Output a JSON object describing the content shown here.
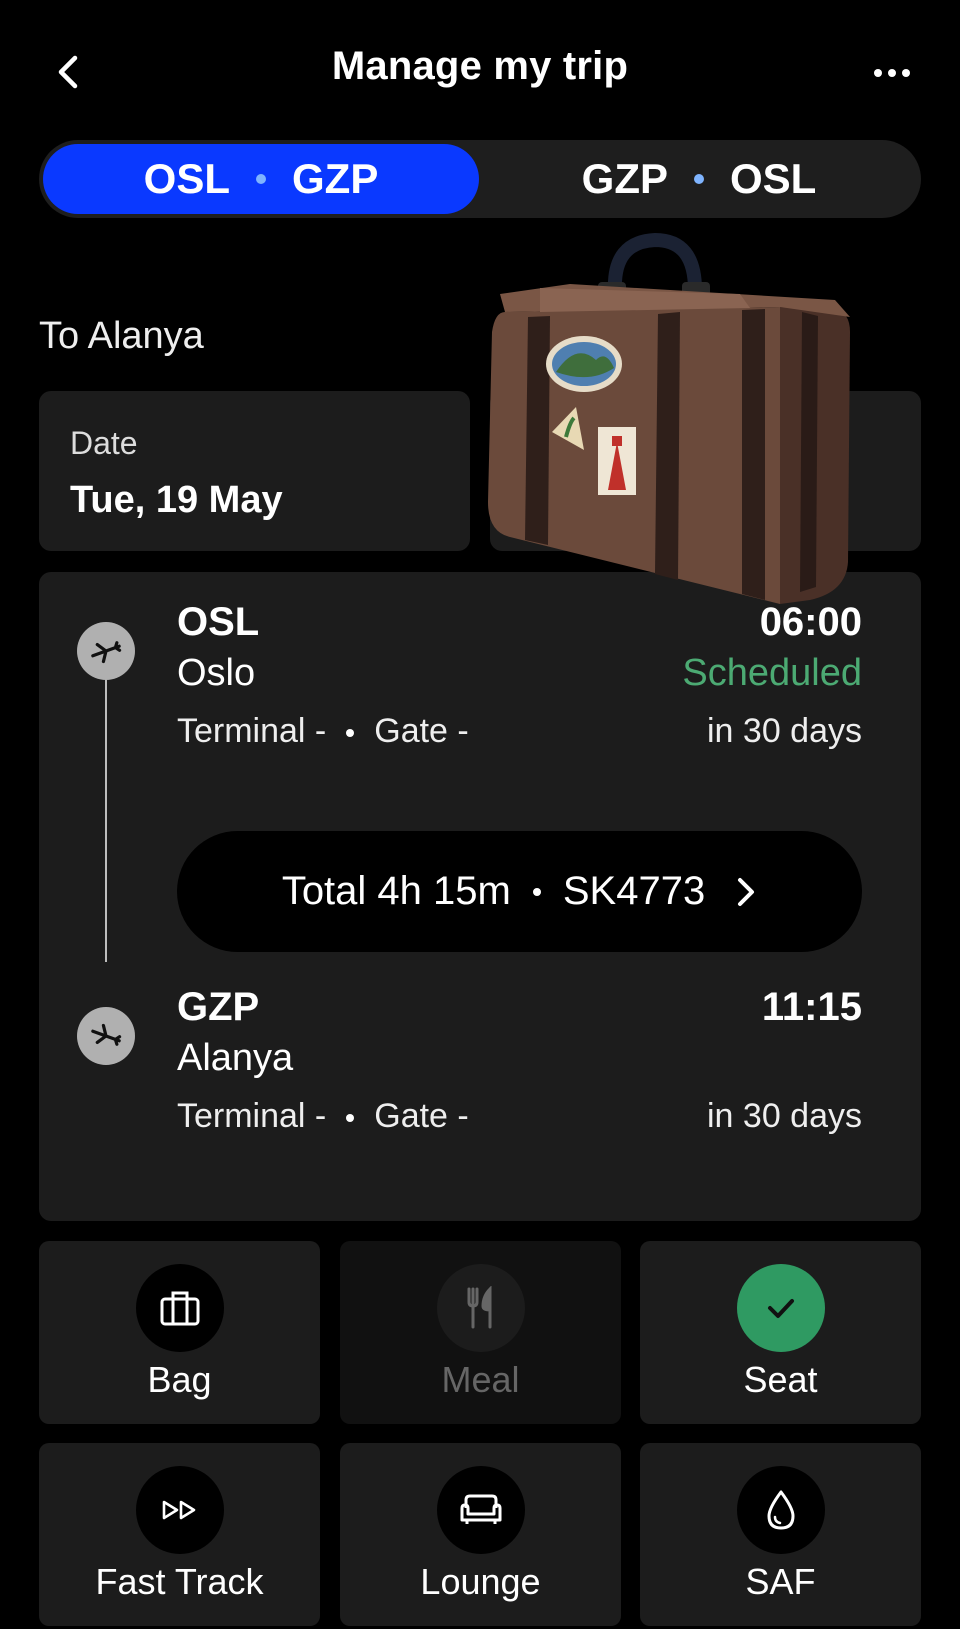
{
  "header": {
    "title": "Manage my trip",
    "back_icon": "chevron-left-icon",
    "more_icon": "more-horizontal-icon"
  },
  "segments": [
    {
      "from": "OSL",
      "to": "GZP",
      "active": true
    },
    {
      "from": "GZP",
      "to": "OSL",
      "active": false
    }
  ],
  "destination_label": "To Alanya",
  "date": {
    "label": "Date",
    "value": "Tue, 19 May"
  },
  "flight": {
    "departure": {
      "code": "OSL",
      "city": "Oslo",
      "terminal": "Terminal -",
      "gate": "Gate -",
      "time": "06:00",
      "status": "Scheduled",
      "relative": "in 30 days"
    },
    "summary": {
      "duration": "Total 4h 15m",
      "flight_number": "SK4773"
    },
    "arrival": {
      "code": "GZP",
      "city": "Alanya",
      "terminal": "Terminal -",
      "gate": "Gate -",
      "time": "11:15",
      "relative": "in 30 days"
    }
  },
  "services": [
    {
      "label": "Bag",
      "icon": "bag-icon"
    },
    {
      "label": "Meal",
      "icon": "fork-knife-icon"
    },
    {
      "label": "Seat",
      "icon": "checkmark-icon"
    },
    {
      "label": "Fast Track",
      "icon": "fast-forward-icon"
    },
    {
      "label": "Lounge",
      "icon": "sofa-icon"
    },
    {
      "label": "SAF",
      "icon": "droplet-icon"
    }
  ],
  "colors": {
    "accent": "#0a39ff",
    "status_green": "#4caa73",
    "check_green": "#2f9a62"
  }
}
